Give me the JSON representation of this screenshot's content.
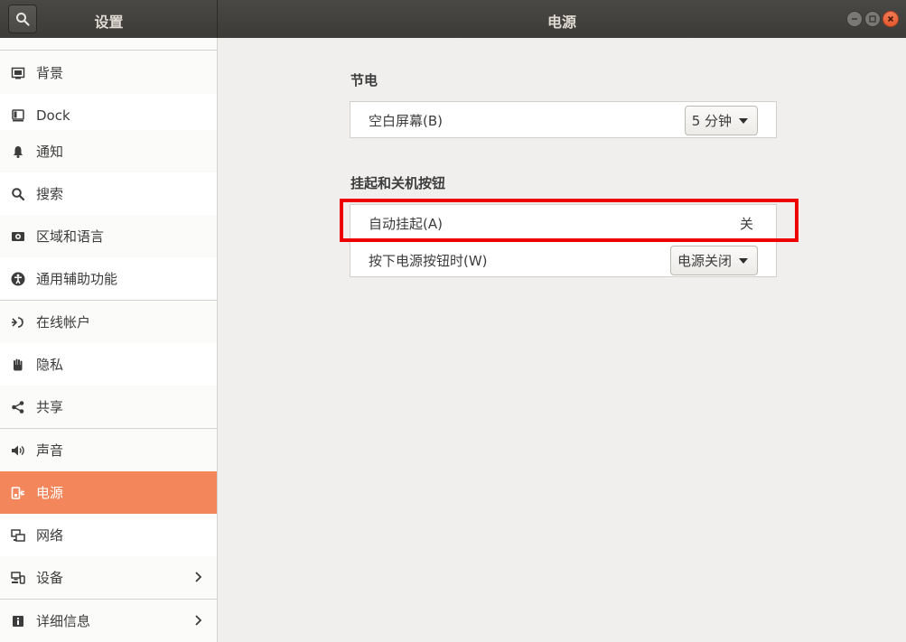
{
  "header": {
    "left_title": "设置",
    "main_title": "电源"
  },
  "sidebar": {
    "items": [
      {
        "label": "背景",
        "icon": "background-icon"
      },
      {
        "label": "Dock",
        "icon": "dock-icon"
      },
      {
        "label": "通知",
        "icon": "bell-icon"
      },
      {
        "label": "搜索",
        "icon": "search-icon"
      },
      {
        "label": "区域和语言",
        "icon": "region-icon"
      },
      {
        "label": "通用辅助功能",
        "icon": "accessibility-icon"
      },
      {
        "label": "在线帐户",
        "icon": "online-accounts-icon"
      },
      {
        "label": "隐私",
        "icon": "hand-icon"
      },
      {
        "label": "共享",
        "icon": "share-icon"
      },
      {
        "label": "声音",
        "icon": "speaker-icon"
      },
      {
        "label": "电源",
        "icon": "power-icon"
      },
      {
        "label": "网络",
        "icon": "network-icon"
      },
      {
        "label": "设备",
        "icon": "devices-icon"
      },
      {
        "label": "详细信息",
        "icon": "info-icon"
      }
    ]
  },
  "power_saving": {
    "title": "节电",
    "blank_screen_label": "空白屏幕(B)",
    "blank_screen_value": "5 分钟"
  },
  "suspend": {
    "title": "挂起和关机按钮",
    "auto_suspend_label": "自动挂起(A)",
    "auto_suspend_value": "关",
    "power_button_label": "按下电源按钮时(W)",
    "power_button_value": "电源关闭"
  },
  "colors": {
    "accent": "#f3875b",
    "highlight": "#ee0000"
  }
}
